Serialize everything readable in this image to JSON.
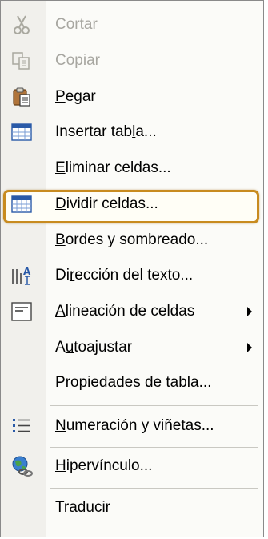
{
  "menu": {
    "items": [
      {
        "pre": "Cor",
        "acc": "t",
        "post": "ar",
        "icon": "scissors-icon",
        "disabled": true
      },
      {
        "pre": "",
        "acc": "C",
        "post": "opiar",
        "icon": "copy-icon",
        "disabled": true
      },
      {
        "pre": "",
        "acc": "P",
        "post": "egar",
        "icon": "paste-icon",
        "disabled": false
      },
      {
        "pre": "Insertar tab",
        "acc": "l",
        "post": "a...",
        "icon": "insert-table-icon",
        "disabled": false
      },
      {
        "pre": "",
        "acc": "E",
        "post": "liminar celdas...",
        "icon": "",
        "disabled": false
      },
      {
        "pre": "",
        "acc": "D",
        "post": "ividir celdas...",
        "icon": "split-cells-icon",
        "disabled": false
      },
      {
        "pre": "",
        "acc": "B",
        "post": "ordes y sombreado...",
        "icon": "",
        "disabled": false
      },
      {
        "pre": "Di",
        "acc": "r",
        "post": "ección del texto...",
        "icon": "text-direction-icon",
        "disabled": false
      },
      {
        "pre": "",
        "acc": "A",
        "post": "lineación de celdas",
        "icon": "cell-alignment-icon",
        "disabled": false
      },
      {
        "pre": "A",
        "acc": "u",
        "post": "toajustar",
        "icon": "",
        "disabled": false
      },
      {
        "pre": "",
        "acc": "P",
        "post": "ropiedades de tabla...",
        "icon": "",
        "disabled": false
      },
      {
        "pre": "",
        "acc": "N",
        "post": "umeración y viñetas...",
        "icon": "bullets-numbering-icon",
        "disabled": false
      },
      {
        "pre": "",
        "acc": "H",
        "post": "ipervínculo...",
        "icon": "hyperlink-globe-icon",
        "disabled": false
      },
      {
        "pre": "Tra",
        "acc": "d",
        "post": "ucir",
        "icon": "",
        "disabled": false
      }
    ],
    "highlight_color": "#c88b1f",
    "disabled_color": "#a7a6a0"
  }
}
